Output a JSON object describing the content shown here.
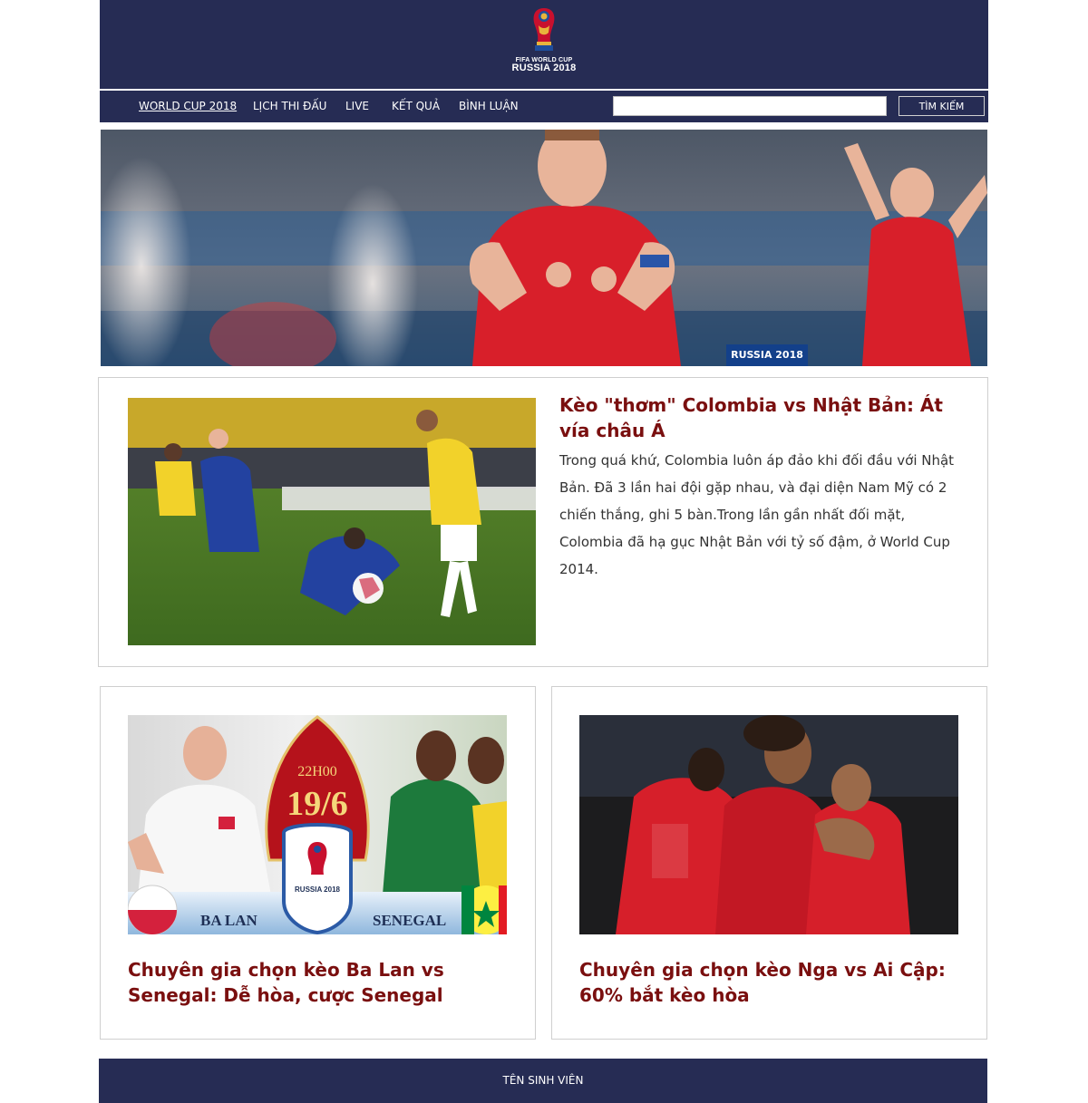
{
  "header": {
    "logo": {
      "line1": "FIFA WORLD CUP",
      "line2": "RUSSIA 2018"
    }
  },
  "nav": {
    "items": [
      {
        "label": "WORLD CUP 2018",
        "active": true
      },
      {
        "label": "LỊCH THI ĐẤU",
        "active": false
      },
      {
        "label": "LIVE",
        "active": false
      },
      {
        "label": "KẾT QUẢ",
        "active": false
      },
      {
        "label": "BÌNH LUẬN",
        "active": false
      }
    ],
    "search": {
      "value": "",
      "button_label": "TÌM KIẾM"
    }
  },
  "hero": {
    "badge": "RUSSIA 2018"
  },
  "featured": {
    "title": "Kèo \"thơm\" Colombia vs Nhật Bản: Át vía châu Á",
    "summary": "Trong quá khứ, Colombia luôn áp đảo khi đối đầu với Nhật Bản. Đã 3 lần hai đội gặp nhau, và đại diện Nam Mỹ có 2 chiến thắng, ghi 5 bàn.Trong lần gần nhất đối mặt, Colombia đã hạ gục Nhật Bản với tỷ số đậm, ở World Cup 2014."
  },
  "articles": [
    {
      "title": "Chuyên gia chọn kèo Ba Lan vs Senegal: Dễ hòa, cược Senegal",
      "image": {
        "time": "22H00",
        "date": "19/6",
        "team_left": "BA LAN",
        "team_right": "SENEGAL",
        "logo_text": "RUSSIA 2018"
      }
    },
    {
      "title": "Chuyên gia chọn kèo Nga vs Ai Cập: 60% bắt kèo hòa"
    }
  ],
  "footer": {
    "text": "TÊN SINH VIÊN"
  },
  "colors": {
    "navy": "#262c54",
    "headline": "#7a0f0f",
    "badge": "#13408a"
  }
}
